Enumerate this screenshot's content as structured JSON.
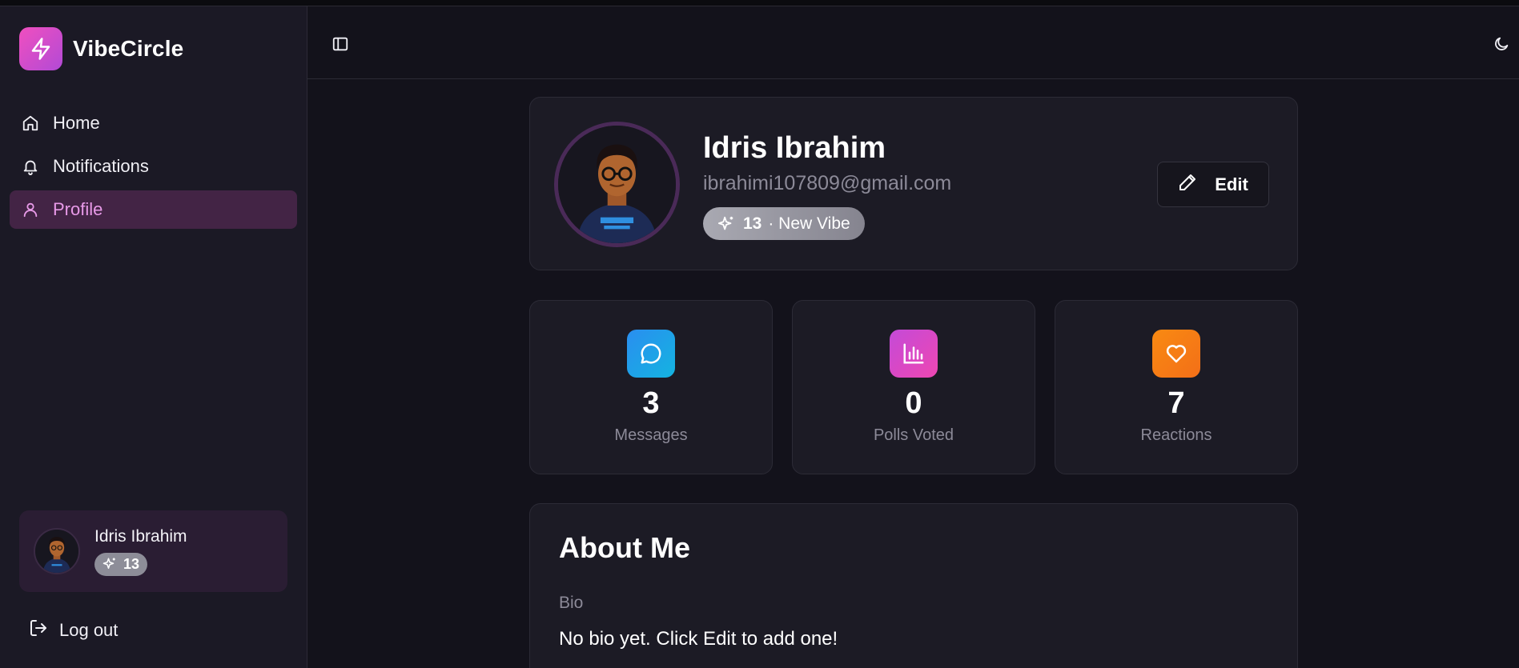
{
  "app": {
    "name": "VibeCircle"
  },
  "sidebar": {
    "items": [
      {
        "label": "Home",
        "icon": "home-icon"
      },
      {
        "label": "Notifications",
        "icon": "bell-icon"
      },
      {
        "label": "Profile",
        "icon": "user-icon",
        "active": true
      }
    ],
    "user": {
      "name": "Idris Ibrahim",
      "vibe_points": "13"
    },
    "logout_label": "Log out"
  },
  "profile": {
    "name": "Idris Ibrahim",
    "email": "ibrahimi107809@gmail.com",
    "vibe_points": "13",
    "vibe_level": "· New Vibe",
    "edit_label": "Edit"
  },
  "stats": [
    {
      "value": "3",
      "label": "Messages",
      "icon": "message-icon",
      "color": "#1fa3e8"
    },
    {
      "value": "0",
      "label": "Polls Voted",
      "icon": "bar-chart-icon",
      "color": "#d845c7"
    },
    {
      "value": "7",
      "label": "Reactions",
      "icon": "heart-icon",
      "color": "#f8870f"
    }
  ],
  "about": {
    "title": "About Me",
    "bio_label": "Bio",
    "bio_text": "No bio yet. Click Edit to add one!"
  },
  "colors": {
    "accent": "#e89ae8",
    "active_bg": "#432445",
    "background": "#13121b",
    "card": "#1c1b25"
  }
}
